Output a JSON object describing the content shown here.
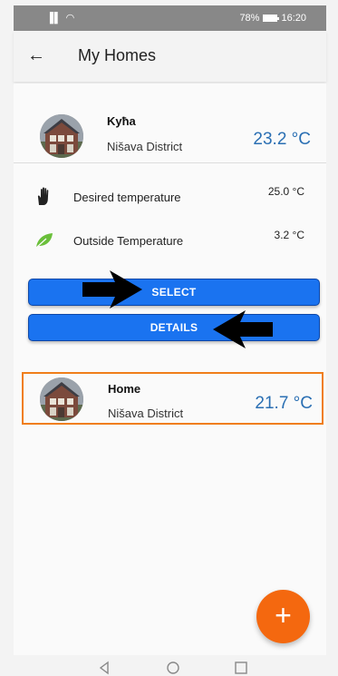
{
  "status_bar": {
    "signal": "▐▌ ◠",
    "battery_percent": "78%",
    "time": "16:20"
  },
  "app_bar": {
    "back_icon": "arrow-left-icon",
    "title": "My Homes"
  },
  "homes": [
    {
      "name": "Kyћa",
      "district": "Nišava District",
      "temperature": "23.2 °C"
    },
    {
      "name": "Home",
      "district": "Nišava District",
      "temperature": "21.7 °C"
    }
  ],
  "details": {
    "desired": {
      "icon": "hand-icon",
      "label": "Desired temperature",
      "value": "25.0 °C"
    },
    "outside": {
      "icon": "leaf-icon",
      "label": "Outside Temperature",
      "value": "3.2 °C"
    }
  },
  "buttons": {
    "select": "SELECT",
    "details": "DETAILS"
  },
  "fab": {
    "icon": "plus-icon",
    "label": "+"
  },
  "colors": {
    "accent_blue": "#1a73f0",
    "temperature_blue": "#2a6fb3",
    "highlight_orange": "#f07e1a",
    "fab_orange": "#f4680f",
    "leaf_green": "#6abf3a"
  }
}
